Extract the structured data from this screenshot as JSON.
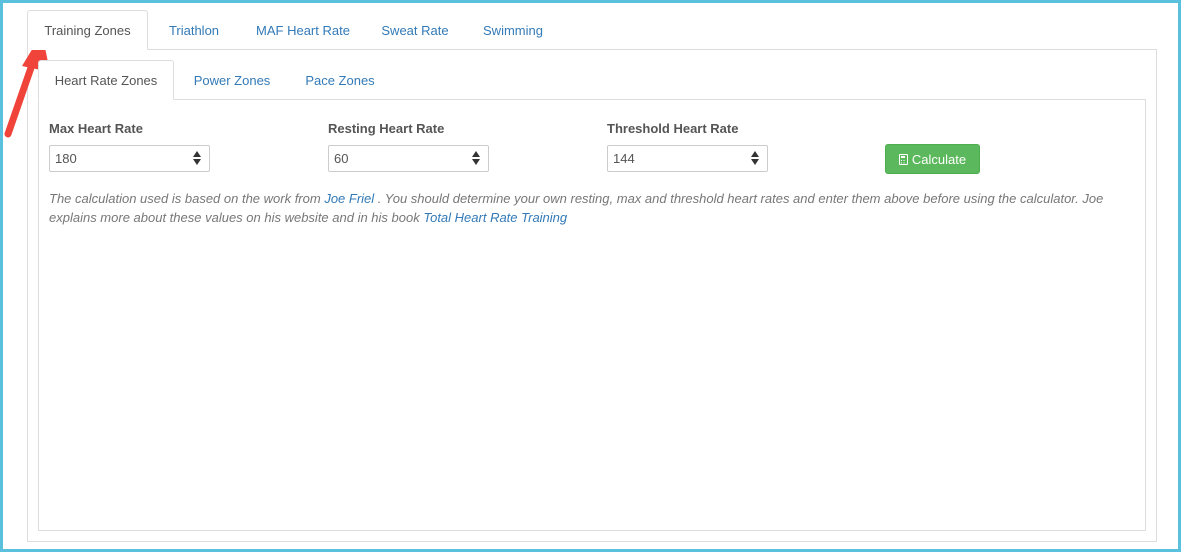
{
  "outer_tabs": [
    {
      "label": "Training Zones",
      "active": true
    },
    {
      "label": "Triathlon",
      "active": false
    },
    {
      "label": "MAF Heart Rate",
      "active": false
    },
    {
      "label": "Sweat Rate",
      "active": false
    },
    {
      "label": "Swimming",
      "active": false
    }
  ],
  "inner_tabs": [
    {
      "label": "Heart Rate Zones",
      "active": true
    },
    {
      "label": "Power Zones",
      "active": false
    },
    {
      "label": "Pace Zones",
      "active": false
    }
  ],
  "form": {
    "max_hr": {
      "label": "Max Heart Rate",
      "value": "180"
    },
    "resting_hr": {
      "label": "Resting Heart Rate",
      "value": "60"
    },
    "threshold_hr": {
      "label": "Threshold Heart Rate",
      "value": "144"
    },
    "calculate_label": "Calculate"
  },
  "help": {
    "part1": "The calculation used is based on the work from ",
    "link1": "Joe Friel",
    "part2": " . You should determine your own resting, max and threshold heart rates and enter them above before using the calculator. Joe explains more about these values on his website and in his book ",
    "link2": "Total Heart Rate Training"
  },
  "icons": {
    "calculate": "calculator-icon",
    "annotation": "red-arrow-icon"
  },
  "colors": {
    "frame": "#5bc0de",
    "link": "#337ab7",
    "button": "#5cb85c",
    "arrow": "#f0443a"
  }
}
